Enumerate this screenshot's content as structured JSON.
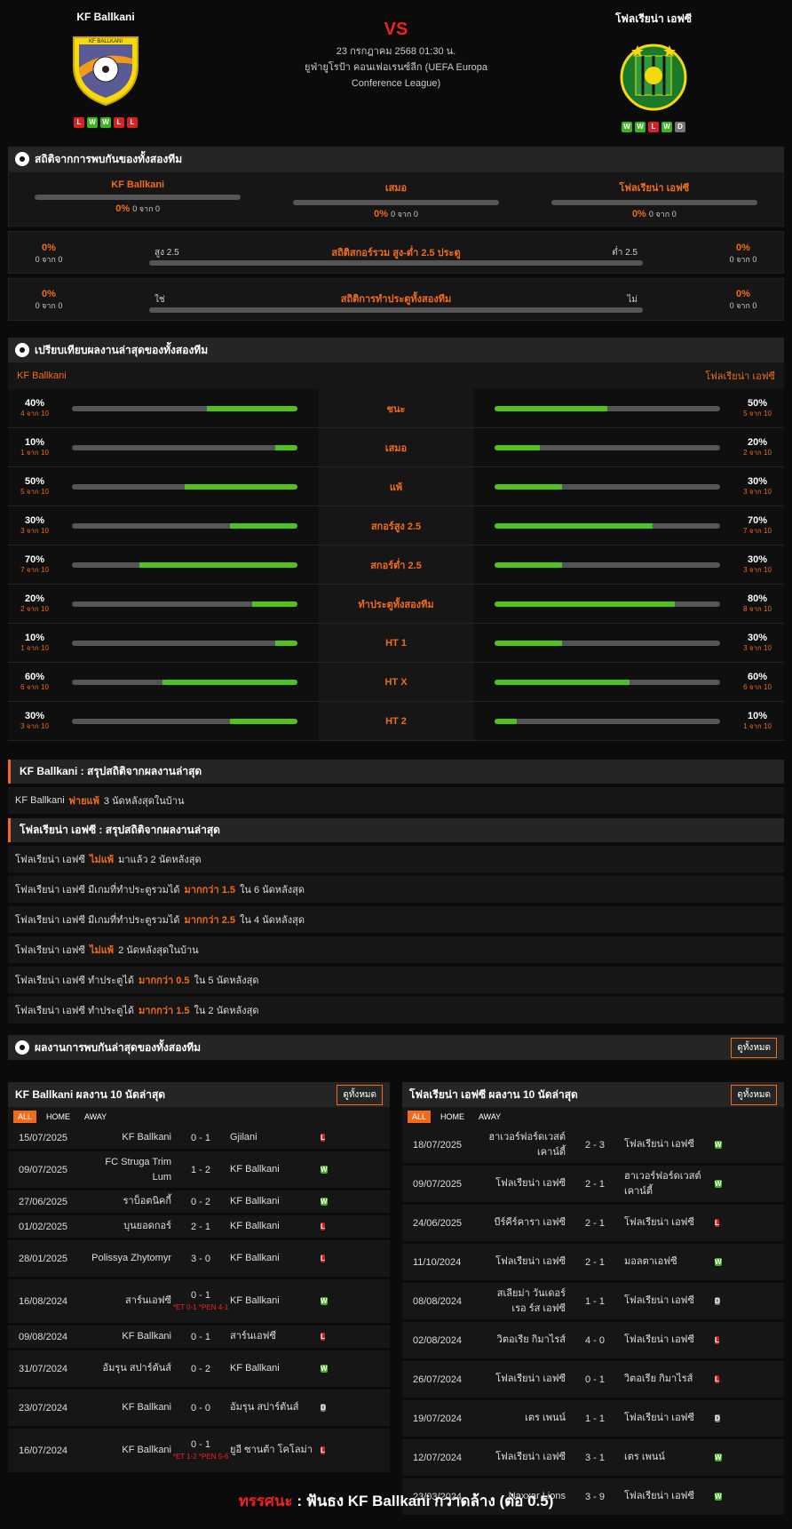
{
  "home": {
    "name": "KF Ballkani",
    "form": [
      "L",
      "W",
      "W",
      "L",
      "L"
    ]
  },
  "away": {
    "name": "โฟลเรียน่า เอฟซี",
    "form": [
      "W",
      "W",
      "L",
      "W",
      "D"
    ]
  },
  "match": {
    "vs": "VS",
    "date": "23 กรกฎาคม 2568 01:30 น.",
    "league": "ยูฟ่ายูโรป้า คอนเฟอเรนซ์ลีก (UEFA Europa Conference League)"
  },
  "h2h": {
    "title": "สถิติจากการพบกันของทั้งสองทีม",
    "home_label": "KF Ballkani",
    "draw_label": "เสมอ",
    "away_label": "โฟลเรียน่า เอฟซี",
    "home_pct": "0%",
    "home_of": "0 จาก 0",
    "draw_pct": "0%",
    "draw_of": "0 จาก 0",
    "away_pct": "0%",
    "away_of": "0 จาก 0"
  },
  "ou": {
    "title": "สถิติสกอร์รวม สูง-ต่ำ 2.5 ประตู",
    "left_pct": "0%",
    "left_of": "0 จาก 0",
    "right_pct": "0%",
    "right_of": "0 จาก 0",
    "over": "สูง 2.5",
    "under": "ต่ำ 2.5"
  },
  "btts": {
    "title": "สถิติการทำประตูทั้งสองทีม",
    "left_pct": "0%",
    "left_of": "0 จาก 0",
    "right_pct": "0%",
    "right_of": "0 จาก 0",
    "yes": "ใช่",
    "no": "ไม่"
  },
  "compare": {
    "title": "เปรียบเทียบผลงานล่าสุดของทั้งสองทีม",
    "home": "KF Ballkani",
    "away": "โฟลเรียน่า เอฟซี",
    "rows": [
      {
        "label": "ชนะ",
        "hp": "40%",
        "hof": "4 จาก 10",
        "hv": 0.4,
        "ap": "50%",
        "aof": "5 จาก 10",
        "av": 0.5
      },
      {
        "label": "เสมอ",
        "hp": "10%",
        "hof": "1 จาก 10",
        "hv": 0.1,
        "ap": "20%",
        "aof": "2 จาก 10",
        "av": 0.2
      },
      {
        "label": "แพ้",
        "hp": "50%",
        "hof": "5 จาก 10",
        "hv": 0.5,
        "ap": "30%",
        "aof": "3 จาก 10",
        "av": 0.3
      },
      {
        "label": "สกอร์สูง 2.5",
        "hp": "30%",
        "hof": "3 จาก 10",
        "hv": 0.3,
        "ap": "70%",
        "aof": "7 จาก 10",
        "av": 0.7
      },
      {
        "label": "สกอร์ต่ำ 2.5",
        "hp": "70%",
        "hof": "7 จาก 10",
        "hv": 0.7,
        "ap": "30%",
        "aof": "3 จาก 10",
        "av": 0.3
      },
      {
        "label": "ทำประตูทั้งสองทีม",
        "hp": "20%",
        "hof": "2 จาก 10",
        "hv": 0.2,
        "ap": "80%",
        "aof": "8 จาก 10",
        "av": 0.8
      },
      {
        "label": "HT 1",
        "hp": "10%",
        "hof": "1 จาก 10",
        "hv": 0.1,
        "ap": "30%",
        "aof": "3 จาก 10",
        "av": 0.3
      },
      {
        "label": "HT X",
        "hp": "60%",
        "hof": "6 จาก 10",
        "hv": 0.6,
        "ap": "60%",
        "aof": "6 จาก 10",
        "av": 0.6
      },
      {
        "label": "HT 2",
        "hp": "30%",
        "hof": "3 จาก 10",
        "hv": 0.3,
        "ap": "10%",
        "aof": "1 จาก 10",
        "av": 0.1
      }
    ]
  },
  "home_summary": {
    "title": "KF Ballkani : สรุปสถิติจากผลงานล่าสุด",
    "rows": [
      [
        "KF Ballkani",
        "พ่ายแพ้",
        "3 นัดหลังสุดในบ้าน"
      ]
    ]
  },
  "away_summary": {
    "title": "โฟลเรียน่า เอฟซี : สรุปสถิติจากผลงานล่าสุด",
    "rows": [
      [
        "โฟลเรียน่า เอฟซี",
        "ไม่แพ้",
        "มาแล้ว 2 นัดหลังสุด"
      ],
      [
        "โฟลเรียน่า เอฟซี มีเกมที่ทำประตูรวมได้",
        "มากกว่า 1.5",
        "ใน 6 นัดหลังสุด"
      ],
      [
        "โฟลเรียน่า เอฟซี มีเกมที่ทำประตูรวมได้",
        "มากกว่า 2.5",
        "ใน 4 นัดหลังสุด"
      ],
      [
        "โฟลเรียน่า เอฟซี",
        "ไม่แพ้",
        "2 นัดหลังสุดในบ้าน"
      ],
      [
        "โฟลเรียน่า เอฟซี ทำประตูได้",
        "มากกว่า 0.5",
        "ใน 5 นัดหลังสุด"
      ],
      [
        "โฟลเรียน่า เอฟซี ทำประตูได้",
        "มากกว่า 1.5",
        "ใน 2 นัดหลังสุด"
      ]
    ]
  },
  "recent": {
    "title": "ผลงานการพบกันล่าสุดของทั้งสองทีม",
    "view_all": "ดูทั้งหมด"
  },
  "tabs": [
    "ALL",
    "HOME",
    "AWAY"
  ],
  "home_last": {
    "title": "KF Ballkani ผลงาน 10 นัดล่าสุด",
    "view_all": "ดูทั้งหมด",
    "rows": [
      {
        "d": "15/07/2025",
        "h": "KF Ballkani",
        "s": "0 - 1",
        "e": "",
        "a": "Gjilani",
        "r": "L"
      },
      {
        "d": "09/07/2025",
        "h": "FC Struga Trim Lum",
        "s": "1 - 2",
        "e": "",
        "a": "KF Ballkani",
        "r": "W"
      },
      {
        "d": "27/06/2025",
        "h": "ราบ็อตนิคกี้",
        "s": "0 - 2",
        "e": "",
        "a": "KF Ballkani",
        "r": "W"
      },
      {
        "d": "01/02/2025",
        "h": "บุนยอดกอร์",
        "s": "2 - 1",
        "e": "",
        "a": "KF Ballkani",
        "r": "L"
      },
      {
        "d": "28/01/2025",
        "h": "Polissya Zhytomyr",
        "s": "3 - 0",
        "e": "",
        "a": "KF Ballkani",
        "r": "L"
      },
      {
        "d": "16/08/2024",
        "h": "สาร์นเอฟซี",
        "s": "0 - 1",
        "e": "*ET 0-1 *PEN 4-1",
        "a": "KF Ballkani",
        "r": "W"
      },
      {
        "d": "09/08/2024",
        "h": "KF Ballkani",
        "s": "0 - 1",
        "e": "",
        "a": "สาร์นเอฟซี",
        "r": "L"
      },
      {
        "d": "31/07/2024",
        "h": "อัมรุน สปาร์ตันส์",
        "s": "0 - 2",
        "e": "",
        "a": "KF Ballkani",
        "r": "W"
      },
      {
        "d": "23/07/2024",
        "h": "KF Ballkani",
        "s": "0 - 0",
        "e": "",
        "a": "อัมรุน สปาร์ตันส์",
        "r": "D"
      },
      {
        "d": "16/07/2024",
        "h": "KF Ballkani",
        "s": "0 - 1",
        "e": "*ET 1-2 *PEN 5-6",
        "a": "ยูอี ซานต้า โคโลม่า",
        "r": "L"
      }
    ]
  },
  "away_last": {
    "title": "โฟลเรียน่า เอฟซี ผลงาน 10 นัดล่าสุด",
    "view_all": "ดูทั้งหมด",
    "rows": [
      {
        "d": "18/07/2025",
        "h": "ฮาเวอร์ฟอร์ดเวสต์ เคาน์ตี้",
        "s": "2 - 3",
        "e": "",
        "a": "โฟลเรียน่า เอฟซี",
        "r": "W"
      },
      {
        "d": "09/07/2025",
        "h": "โฟลเรียน่า เอฟซี",
        "s": "2 - 1",
        "e": "",
        "a": "ฮาเวอร์ฟอร์ดเวสต์ เคาน์ตี้",
        "r": "W"
      },
      {
        "d": "24/06/2025",
        "h": "บีร์คีร์คารา เอฟซี",
        "s": "2 - 1",
        "e": "",
        "a": "โฟลเรียน่า เอฟซี",
        "r": "L"
      },
      {
        "d": "11/10/2024",
        "h": "โฟลเรียน่า เอฟซี",
        "s": "2 - 1",
        "e": "",
        "a": "มอลตาเอฟซี",
        "r": "W"
      },
      {
        "d": "08/08/2024",
        "h": "สเลียม่า วันเดอร์เรอ ร์ส เอฟซี",
        "s": "1 - 1",
        "e": "",
        "a": "โฟลเรียน่า เอฟซี",
        "r": "D"
      },
      {
        "d": "02/08/2024",
        "h": "วิตอเรีย กิมาไรส์",
        "s": "4 - 0",
        "e": "",
        "a": "โฟลเรียน่า เอฟซี",
        "r": "L"
      },
      {
        "d": "26/07/2024",
        "h": "โฟลเรียน่า เอฟซี",
        "s": "0 - 1",
        "e": "",
        "a": "วิตอเรีย กิมาไรส์",
        "r": "L"
      },
      {
        "d": "19/07/2024",
        "h": "เตร เพนน์",
        "s": "1 - 1",
        "e": "",
        "a": "โฟลเรียน่า เอฟซี",
        "r": "D"
      },
      {
        "d": "12/07/2024",
        "h": "โฟลเรียน่า เอฟซี",
        "s": "3 - 1",
        "e": "",
        "a": "เตร เพนน์",
        "r": "W"
      },
      {
        "d": "23/03/2024",
        "h": "Naxxar Lions",
        "s": "3 - 9",
        "e": "",
        "a": "โฟลเรียน่า เอฟซี",
        "r": "W"
      }
    ]
  },
  "tip": {
    "label": "ทรรศนะ",
    "text": ": ฟันธง KF Ballkani กวาดล้าง (ต่อ 0.5)"
  }
}
